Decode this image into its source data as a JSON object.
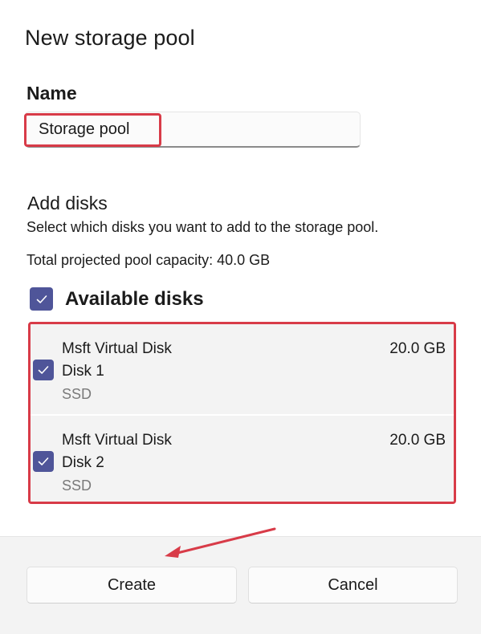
{
  "dialog": {
    "title": "New storage pool"
  },
  "name": {
    "label": "Name",
    "value": "Storage pool"
  },
  "add_disks": {
    "title": "Add disks",
    "description": "Select which disks you want to add to the storage pool.",
    "capacity": "Total projected pool capacity: 40.0 GB",
    "available_label": "Available disks",
    "available_checked": true,
    "disks": [
      {
        "name": "Msft Virtual Disk",
        "id": "Disk 1",
        "type": "SSD",
        "size": "20.0 GB",
        "checked": true
      },
      {
        "name": "Msft Virtual Disk",
        "id": "Disk 2",
        "type": "SSD",
        "size": "20.0 GB",
        "checked": true
      }
    ]
  },
  "footer": {
    "create_label": "Create",
    "cancel_label": "Cancel"
  },
  "colors": {
    "checkbox_accent": "#4f5599",
    "highlight": "#d83b48",
    "annotation_arrow": "#d83b48"
  },
  "icons": {
    "checkbox": "checkmark-icon",
    "annotation": "arrow-icon"
  }
}
